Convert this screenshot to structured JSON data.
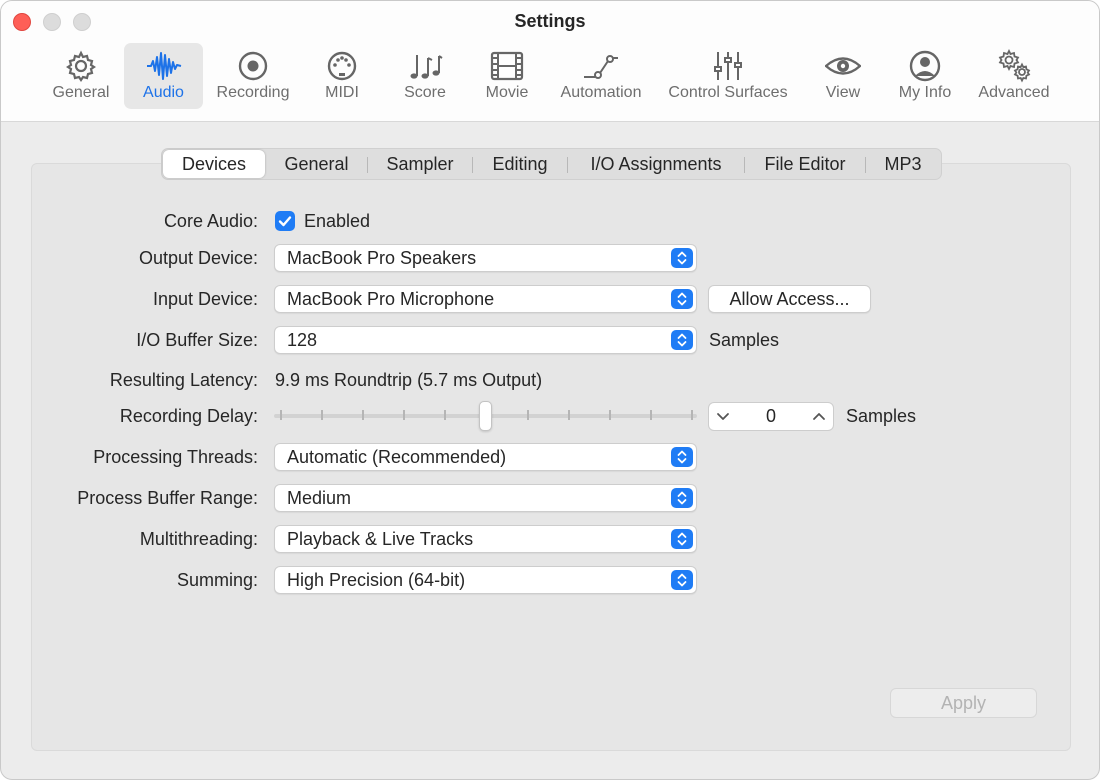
{
  "window": {
    "title": "Settings"
  },
  "toolbar": {
    "items": [
      {
        "label": "General",
        "icon": "gear-icon"
      },
      {
        "label": "Audio",
        "icon": "waveform-icon",
        "selected": true
      },
      {
        "label": "Recording",
        "icon": "record-icon"
      },
      {
        "label": "MIDI",
        "icon": "midi-port-icon"
      },
      {
        "label": "Score",
        "icon": "music-notes-icon"
      },
      {
        "label": "Movie",
        "icon": "film-strip-icon"
      },
      {
        "label": "Automation",
        "icon": "automation-curve-icon"
      },
      {
        "label": "Control Surfaces",
        "icon": "faders-icon"
      },
      {
        "label": "View",
        "icon": "eye-icon"
      },
      {
        "label": "My Info",
        "icon": "person-icon"
      },
      {
        "label": "Advanced",
        "icon": "gears-icon"
      }
    ]
  },
  "tabs": [
    {
      "label": "Devices",
      "active": true
    },
    {
      "label": "General"
    },
    {
      "label": "Sampler"
    },
    {
      "label": "Editing"
    },
    {
      "label": "I/O Assignments"
    },
    {
      "label": "File Editor"
    },
    {
      "label": "MP3"
    }
  ],
  "form": {
    "core_audio": {
      "label": "Core Audio:",
      "checkbox_label": "Enabled",
      "checked": true
    },
    "output_device": {
      "label": "Output Device:",
      "value": "MacBook Pro Speakers"
    },
    "input_device": {
      "label": "Input Device:",
      "value": "MacBook Pro Microphone",
      "button": "Allow Access..."
    },
    "io_buffer": {
      "label": "I/O Buffer Size:",
      "value": "128",
      "unit": "Samples"
    },
    "latency": {
      "label": "Resulting Latency:",
      "value": "9.9 ms Roundtrip (5.7 ms Output)"
    },
    "recording_delay": {
      "label": "Recording Delay:",
      "value": "0",
      "unit": "Samples",
      "slider_position": 0.5
    },
    "processing_threads": {
      "label": "Processing Threads:",
      "value": "Automatic (Recommended)"
    },
    "process_buffer_range": {
      "label": "Process Buffer Range:",
      "value": "Medium"
    },
    "multithreading": {
      "label": "Multithreading:",
      "value": "Playback & Live Tracks"
    },
    "summing": {
      "label": "Summing:",
      "value": "High Precision (64-bit)"
    }
  },
  "footer": {
    "apply_label": "Apply",
    "apply_enabled": false
  },
  "colors": {
    "accent": "#1f7cf5",
    "close": "#fe5f57",
    "selected_tool_text": "#1d72e8"
  }
}
